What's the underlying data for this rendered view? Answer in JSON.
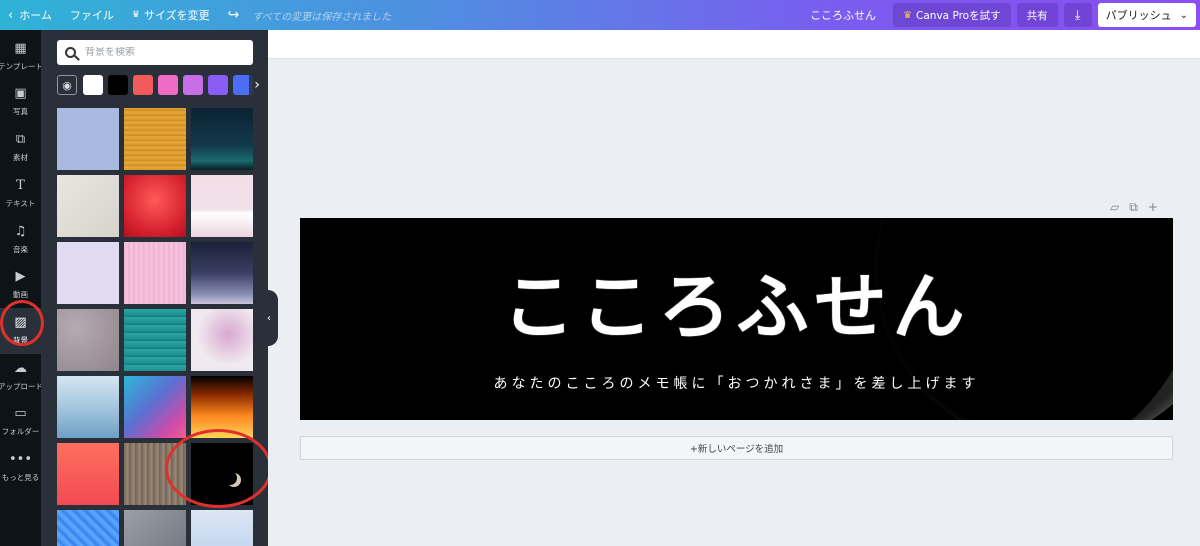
{
  "topbar": {
    "home_label": "ホーム",
    "file_label": "ファイル",
    "resize_label": "サイズを変更",
    "saved_status": "すべての変更は保存されました",
    "doc_title": "こころふせん",
    "pro_label": "Canva Proを試す",
    "share_label": "共有",
    "publish_label": "パブリッシュ"
  },
  "rail": {
    "items": [
      {
        "label": "テンプレート",
        "icon": "template-icon"
      },
      {
        "label": "写真",
        "icon": "photo-icon"
      },
      {
        "label": "素材",
        "icon": "elements-icon"
      },
      {
        "label": "テキスト",
        "icon": "text-icon"
      },
      {
        "label": "音楽",
        "icon": "music-icon"
      },
      {
        "label": "動画",
        "icon": "video-icon"
      },
      {
        "label": "背景",
        "icon": "background-icon"
      },
      {
        "label": "アップロード",
        "icon": "upload-icon"
      },
      {
        "label": "フォルダー",
        "icon": "folder-icon"
      },
      {
        "label": "もっと見る",
        "icon": "more-icon"
      }
    ]
  },
  "panel": {
    "search_placeholder": "背景を検索",
    "swatch_colors": [
      "#ffffff",
      "#000000",
      "#f25b5b",
      "#f06bc4",
      "#c56ee8",
      "#8b5cf6",
      "#4c6ef5"
    ]
  },
  "canvas": {
    "title_text": "こころふせん",
    "subtitle_text": "あなたのこころのメモ帳に「おつかれさま」を差し上げます",
    "add_page_label": "+新しいページを追加"
  },
  "colors": {
    "accent_red_circle": "#e0302a",
    "panel_bg": "#293039",
    "rail_bg": "#0e1318"
  }
}
